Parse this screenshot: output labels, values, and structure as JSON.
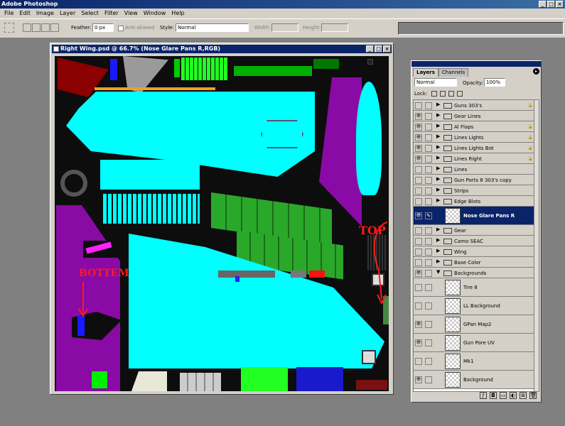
{
  "app": {
    "title": "Adobe Photoshop"
  },
  "menu": [
    "File",
    "Edit",
    "Image",
    "Layer",
    "Select",
    "Filter",
    "View",
    "Window",
    "Help"
  ],
  "options": {
    "feather_label": "Feather:",
    "feather_value": "0 px",
    "antialiased_label": "Anti-aliased",
    "style_label": "Style:",
    "style_value": "Normal",
    "width_label": "Width:",
    "height_label": "Height:"
  },
  "document": {
    "title": "Right Wing.psd @ 66.7% (Nose Glare Pans R,RGB)",
    "annotations": {
      "top": "TOP",
      "bottom": "BOTTEM"
    }
  },
  "layers_panel": {
    "tabs": [
      "Layers",
      "Channels"
    ],
    "blend_mode": "Normal",
    "opacity_label": "Opacity:",
    "opacity_value": "100%",
    "lock_label": "Lock:",
    "layers": [
      {
        "name": "Guns 303's",
        "type": "group",
        "visible": false,
        "locked": true
      },
      {
        "name": "Gear Lines",
        "type": "group",
        "visible": true,
        "locked": false
      },
      {
        "name": "Al Flaps",
        "type": "group",
        "visible": true,
        "locked": true
      },
      {
        "name": "Lines Lights",
        "type": "group",
        "visible": true,
        "locked": true
      },
      {
        "name": "Lines Lights Bot",
        "type": "group",
        "visible": true,
        "locked": true
      },
      {
        "name": "Lines Right",
        "type": "group",
        "visible": true,
        "locked": true
      },
      {
        "name": "Lines",
        "type": "group",
        "visible": false,
        "locked": false
      },
      {
        "name": "Gun Ports 8 303's copy",
        "type": "group",
        "visible": false,
        "locked": false
      },
      {
        "name": "Strips",
        "type": "group",
        "visible": false,
        "locked": false
      },
      {
        "name": "Edge Blots",
        "type": "group",
        "visible": false,
        "locked": false
      },
      {
        "name": "Nose Glare Pans R",
        "type": "layer",
        "visible": true,
        "locked": false,
        "selected": true
      },
      {
        "name": "Gear",
        "type": "group",
        "visible": false,
        "locked": false
      },
      {
        "name": "Camo SEAC",
        "type": "group",
        "visible": false,
        "locked": false
      },
      {
        "name": "Wing",
        "type": "group",
        "visible": false,
        "locked": false
      },
      {
        "name": "Base Color",
        "type": "group",
        "visible": false,
        "locked": false
      },
      {
        "name": "Backgrounds",
        "type": "group-open",
        "visible": true,
        "locked": false
      },
      {
        "name": "Tire 8",
        "type": "layer",
        "visible": false,
        "locked": false
      },
      {
        "name": "LL Background",
        "type": "layer",
        "visible": false,
        "locked": false
      },
      {
        "name": "GPan Map2",
        "type": "layer",
        "visible": true,
        "locked": false
      },
      {
        "name": "Gun Pore UV",
        "type": "layer",
        "visible": true,
        "locked": false
      },
      {
        "name": "Mk1",
        "type": "layer",
        "visible": false,
        "locked": false
      },
      {
        "name": "Background",
        "type": "layer",
        "visible": true,
        "locked": false
      }
    ]
  }
}
